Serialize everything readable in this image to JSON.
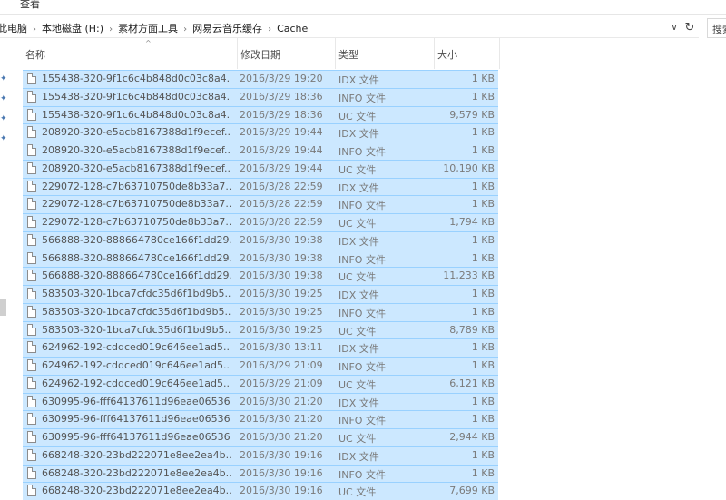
{
  "ribbon": {
    "tab_view": "查看"
  },
  "address": {
    "crumbs": [
      "此电脑",
      "本地磁盘 (H:)",
      "素材方面工具",
      "网易云音乐缓存",
      "Cache"
    ],
    "separator_icon": "chevron-right-icon",
    "dropdown_icon": "chevron-down-icon",
    "refresh_icon": "refresh-icon"
  },
  "search": {
    "placeholder": "搜索"
  },
  "columns": {
    "name": "名称",
    "date": "修改日期",
    "type": "类型",
    "size": "大小"
  },
  "colors": {
    "selection_bg": "#cce8ff",
    "selection_border": "#99d1ff"
  },
  "files": [
    {
      "name": "155438-320-9f1c6c4b848d0c03c8a4...",
      "date": "2016/3/29 19:20",
      "type": "IDX 文件",
      "size": "1 KB"
    },
    {
      "name": "155438-320-9f1c6c4b848d0c03c8a4...",
      "date": "2016/3/29 18:36",
      "type": "INFO 文件",
      "size": "1 KB"
    },
    {
      "name": "155438-320-9f1c6c4b848d0c03c8a4...",
      "date": "2016/3/29 18:36",
      "type": "UC 文件",
      "size": "9,579 KB"
    },
    {
      "name": "208920-320-e5acb8167388d1f9ecef...",
      "date": "2016/3/29 19:44",
      "type": "IDX 文件",
      "size": "1 KB"
    },
    {
      "name": "208920-320-e5acb8167388d1f9ecef...",
      "date": "2016/3/29 19:44",
      "type": "INFO 文件",
      "size": "1 KB"
    },
    {
      "name": "208920-320-e5acb8167388d1f9ecef...",
      "date": "2016/3/29 19:44",
      "type": "UC 文件",
      "size": "10,190 KB"
    },
    {
      "name": "229072-128-c7b63710750de8b33a7...",
      "date": "2016/3/28 22:59",
      "type": "IDX 文件",
      "size": "1 KB"
    },
    {
      "name": "229072-128-c7b63710750de8b33a7...",
      "date": "2016/3/28 22:59",
      "type": "INFO 文件",
      "size": "1 KB"
    },
    {
      "name": "229072-128-c7b63710750de8b33a7...",
      "date": "2016/3/28 22:59",
      "type": "UC 文件",
      "size": "1,794 KB"
    },
    {
      "name": "566888-320-888664780ce166f1dd29...",
      "date": "2016/3/30 19:38",
      "type": "IDX 文件",
      "size": "1 KB"
    },
    {
      "name": "566888-320-888664780ce166f1dd29...",
      "date": "2016/3/30 19:38",
      "type": "INFO 文件",
      "size": "1 KB"
    },
    {
      "name": "566888-320-888664780ce166f1dd29...",
      "date": "2016/3/30 19:38",
      "type": "UC 文件",
      "size": "11,233 KB"
    },
    {
      "name": "583503-320-1bca7cfdc35d6f1bd9b5...",
      "date": "2016/3/30 19:25",
      "type": "IDX 文件",
      "size": "1 KB"
    },
    {
      "name": "583503-320-1bca7cfdc35d6f1bd9b5...",
      "date": "2016/3/30 19:25",
      "type": "INFO 文件",
      "size": "1 KB"
    },
    {
      "name": "583503-320-1bca7cfdc35d6f1bd9b5...",
      "date": "2016/3/30 19:25",
      "type": "UC 文件",
      "size": "8,789 KB"
    },
    {
      "name": "624962-192-cddced019c646ee1ad5...",
      "date": "2016/3/30 13:11",
      "type": "IDX 文件",
      "size": "1 KB"
    },
    {
      "name": "624962-192-cddced019c646ee1ad5...",
      "date": "2016/3/29 21:09",
      "type": "INFO 文件",
      "size": "1 KB"
    },
    {
      "name": "624962-192-cddced019c646ee1ad5...",
      "date": "2016/3/29 21:09",
      "type": "UC 文件",
      "size": "6,121 KB"
    },
    {
      "name": "630995-96-fff64137611d96eae06536...",
      "date": "2016/3/30 21:20",
      "type": "IDX 文件",
      "size": "1 KB"
    },
    {
      "name": "630995-96-fff64137611d96eae06536...",
      "date": "2016/3/30 21:20",
      "type": "INFO 文件",
      "size": "1 KB"
    },
    {
      "name": "630995-96-fff64137611d96eae06536...",
      "date": "2016/3/30 21:20",
      "type": "UC 文件",
      "size": "2,944 KB"
    },
    {
      "name": "668248-320-23bd222071e8ee2ea4b...",
      "date": "2016/3/30 19:16",
      "type": "IDX 文件",
      "size": "1 KB"
    },
    {
      "name": "668248-320-23bd222071e8ee2ea4b...",
      "date": "2016/3/30 19:16",
      "type": "INFO 文件",
      "size": "1 KB"
    },
    {
      "name": "668248-320-23bd222071e8ee2ea4b...",
      "date": "2016/3/30 19:16",
      "type": "UC 文件",
      "size": "7,699 KB"
    }
  ]
}
